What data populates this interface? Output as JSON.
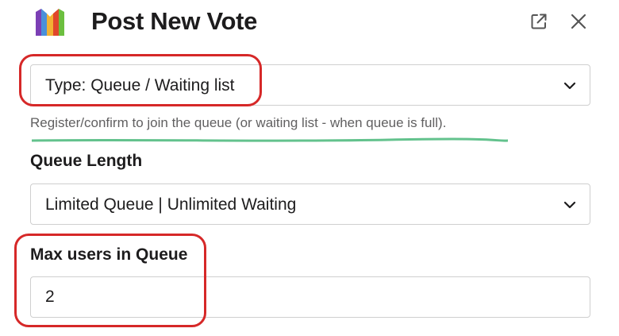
{
  "header": {
    "title": "Post New Vote",
    "logo_icon": "app-logo-icon",
    "popout_icon": "external-link-icon",
    "close_icon": "close-icon"
  },
  "form": {
    "type_select": {
      "value": "Type: Queue / Waiting list"
    },
    "type_hint": "Register/confirm to join the queue (or waiting list - when queue is full).",
    "queue_length": {
      "label": "Queue Length",
      "value": "Limited Queue | Unlimited Waiting"
    },
    "max_users": {
      "label": "Max users in Queue",
      "value": "2"
    }
  },
  "annotations": {
    "highlight_color": "#d62828",
    "underline_color": "#3cb371"
  }
}
